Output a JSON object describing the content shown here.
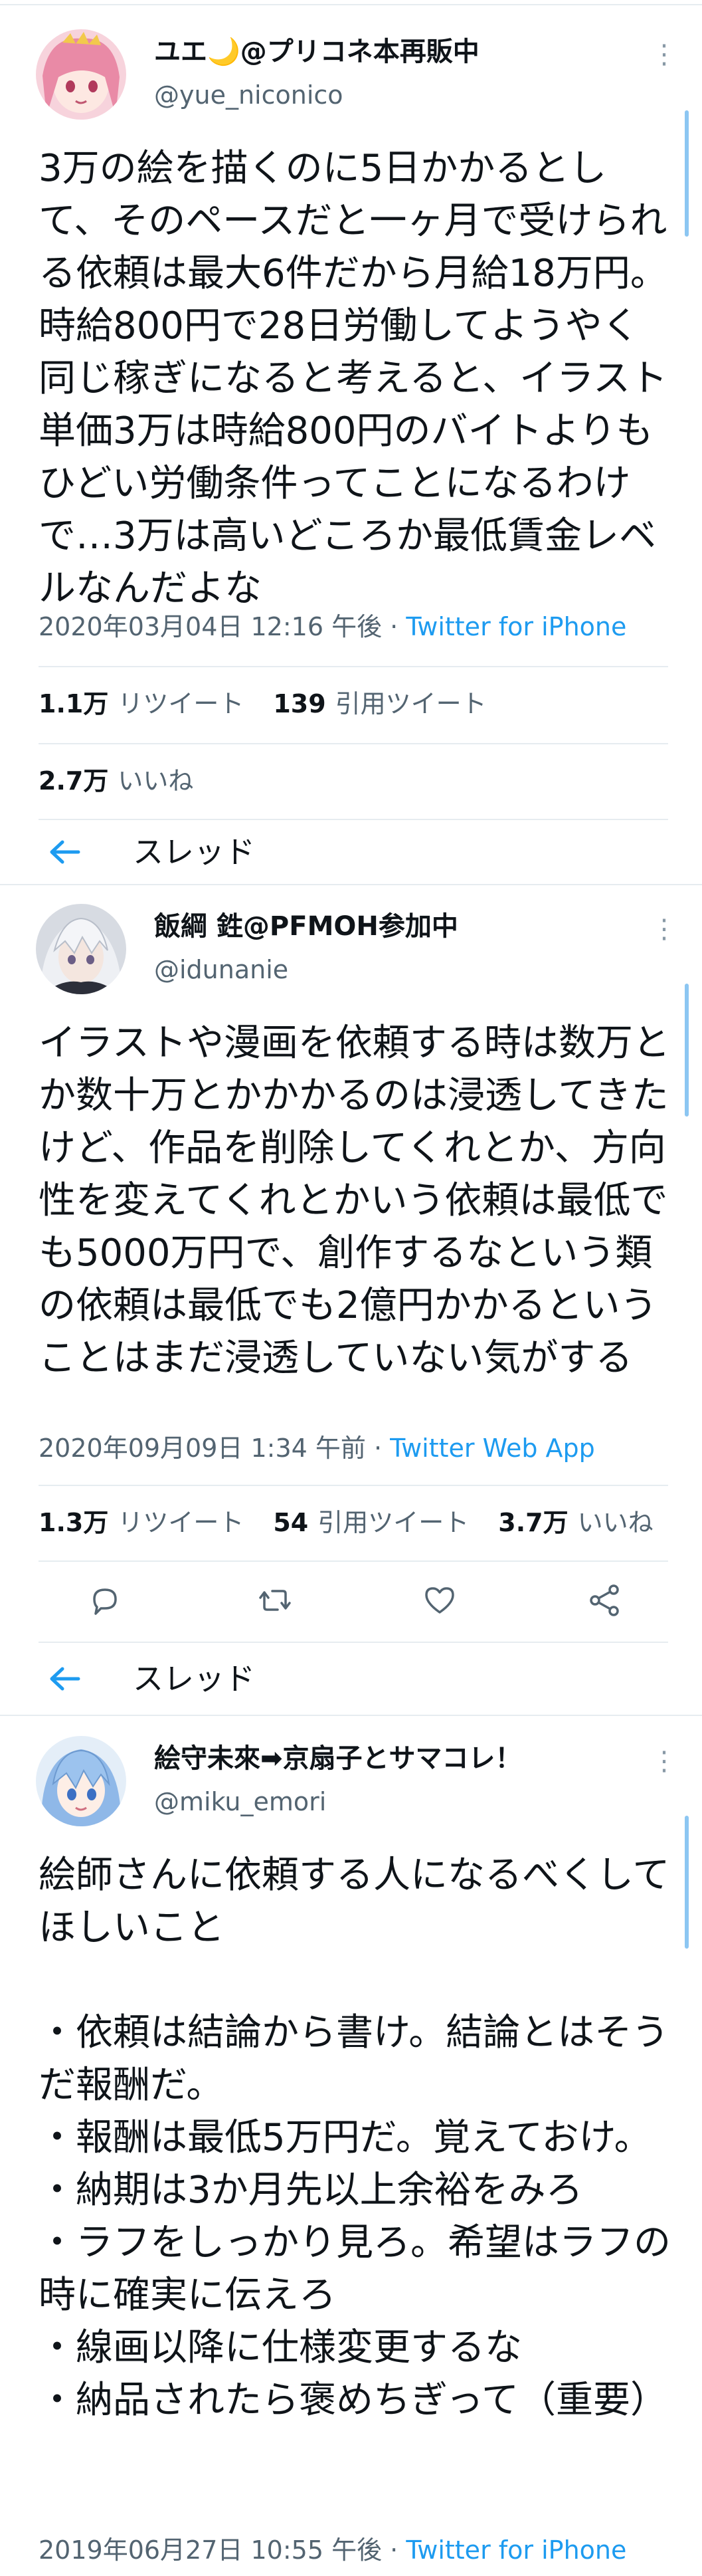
{
  "tweets": [
    {
      "name": "ユエ🌙@プリコネ本再販中",
      "handle": "@yue_niconico",
      "text": "3万の絵を描くのに5日かかるとして、そのペースだと一ヶ月で受けられる依頼は最大6件だから月給18万円。時給800円で28日労働してようやく同じ稼ぎになると考えると、イラスト単価3万は時給800円のバイトよりもひどい労働条件ってことになるわけで…3万は高いどころか最低賃金レベルなんだよな",
      "timestamp": "2020年03月04日 12:16 午後 · ",
      "via": "Twitter for iPhone",
      "retweets_count": "1.1万",
      "retweets_label": "リツイート",
      "quotes_count": "139",
      "quotes_label": "引用ツイート",
      "likes_count": "2.7万",
      "likes_label": "いいね",
      "thread_label": "スレッド"
    },
    {
      "name": "飯綱 鉎@PFMOH参加中",
      "handle": "@idunanie",
      "text": "イラストや漫画を依頼する時は数万とか数十万とかかかるのは浸透してきたけど、作品を削除してくれとか、方向性を変えてくれとかいう依頼は最低でも5000万円で、創作するなという類の依頼は最低でも2億円かかるということはまだ浸透していない気がする",
      "timestamp": "2020年09月09日 1:34 午前 · ",
      "via": "Twitter Web App",
      "retweets_count": "1.3万",
      "retweets_label": "リツイート",
      "quotes_count": "54",
      "quotes_label": "引用ツイート",
      "likes_count": "3.7万",
      "likes_label": "いいね",
      "thread_label": "スレッド"
    },
    {
      "name": "絵守未來➡京扇子とサマコレ！",
      "handle": "@miku_emori",
      "text": "絵師さんに依頼する人になるべくしてほしいこと\n\n・依頼は結論から書け。結論とはそうだ報酬だ。\n・報酬は最低5万円だ。覚えておけ。\n・納期は3か月先以上余裕をみろ\n・ラフをしっかり見ろ。希望はラフの時に確実に伝えろ\n・線画以降に仕様変更するな\n・納品されたら褒めちぎって（重要）",
      "timestamp": "2019年06月27日 10:55 午後 · ",
      "via": "Twitter for iPhone"
    }
  ],
  "icons": {
    "reply": "reply-icon",
    "retweet": "retweet-icon",
    "like": "heart-icon",
    "share": "share-icon",
    "back": "arrow-left-icon",
    "more": "more-vertical-icon"
  },
  "colors": {
    "link": "#1d9bf0",
    "secondary_text": "#536471",
    "primary_text": "#0f1419",
    "divider": "#e6ecf0"
  }
}
